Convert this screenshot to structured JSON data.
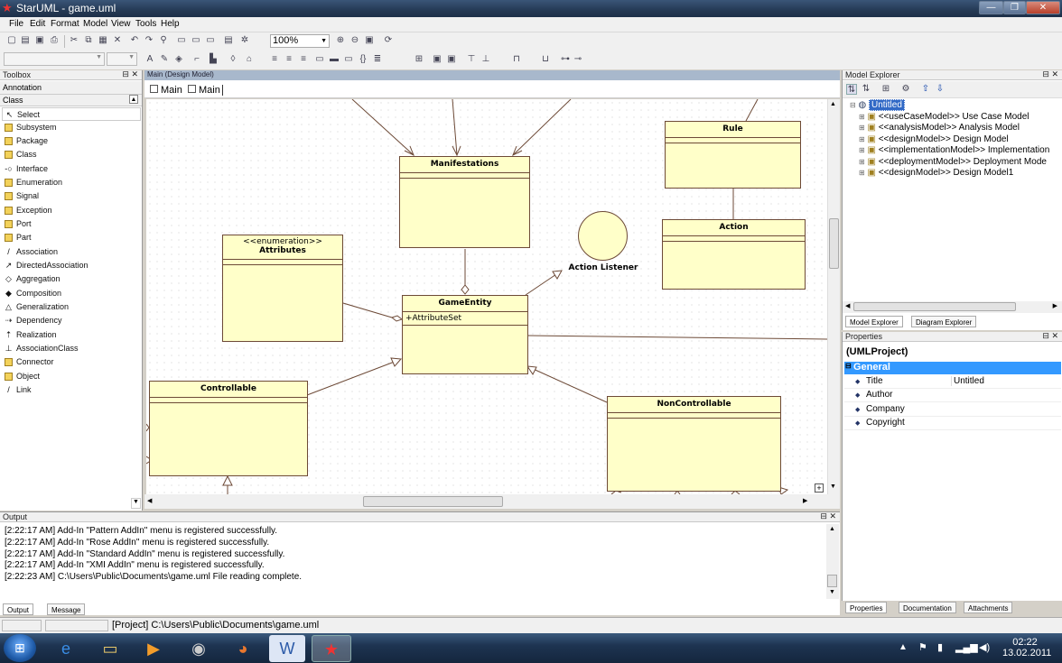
{
  "window": {
    "title": "StarUML - game.uml"
  },
  "menu": [
    "File",
    "Edit",
    "Format",
    "Model",
    "View",
    "Tools",
    "Help"
  ],
  "toolbar": {
    "zoom": "100%"
  },
  "toolbox": {
    "title": "Toolbox",
    "section_annotation": "Annotation",
    "section_class": "Class",
    "items": [
      "Select",
      "Subsystem",
      "Package",
      "Class",
      "Interface",
      "Enumeration",
      "Signal",
      "Exception",
      "Port",
      "Part",
      "Association",
      "DirectedAssociation",
      "Aggregation",
      "Composition",
      "Generalization",
      "Dependency",
      "Realization",
      "AssociationClass",
      "Connector",
      "Object",
      "Link"
    ]
  },
  "diagram": {
    "header": "Main (Design Model)",
    "tabs": [
      "Main",
      "Main"
    ],
    "classes": {
      "manifestations": "Manifestations",
      "rule": "Rule",
      "action": "Action",
      "attributes_stereo": "<<enumeration>>",
      "attributes": "Attributes",
      "gameentity": "GameEntity",
      "gameentity_attr": "+AttributeSet",
      "controllable": "Controllable",
      "noncontrollable": "NonControllable"
    },
    "interface_label": "Action Listener"
  },
  "explorer": {
    "title": "Model Explorer",
    "root": "Untitled",
    "items": [
      "<<useCaseModel>> Use Case Model",
      "<<analysisModel>> Analysis Model",
      "<<designModel>> Design Model",
      "<<implementationModel>> Implementation",
      "<<deploymentModel>> Deployment Mode",
      "<<designModel>> Design Model1"
    ],
    "tabs": [
      "Model Explorer",
      "Diagram Explorer"
    ]
  },
  "properties": {
    "title": "Properties",
    "object": "(UMLProject)",
    "group": "General",
    "rows": [
      {
        "k": "Title",
        "v": "Untitled"
      },
      {
        "k": "Author",
        "v": ""
      },
      {
        "k": "Company",
        "v": ""
      },
      {
        "k": "Copyright",
        "v": ""
      }
    ],
    "tabs": [
      "Properties",
      "Documentation",
      "Attachments"
    ]
  },
  "output": {
    "title": "Output",
    "lines": [
      "[2:22:17 AM]  Add-In \"Pattern AddIn\" menu is registered successfully.",
      "[2:22:17 AM]  Add-In \"Rose AddIn\" menu is registered successfully.",
      "[2:22:17 AM]  Add-In \"Standard AddIn\" menu is registered successfully.",
      "[2:22:17 AM]  Add-In \"XMI AddIn\" menu is registered successfully.",
      "[2:22:23 AM]  C:\\Users\\Public\\Documents\\game.uml File reading complete."
    ],
    "tabs": [
      "Output",
      "Message"
    ]
  },
  "status": {
    "path": "[Project] C:\\Users\\Public\\Documents\\game.uml"
  },
  "clock": {
    "time": "02:22",
    "date": "13.02.2011"
  }
}
